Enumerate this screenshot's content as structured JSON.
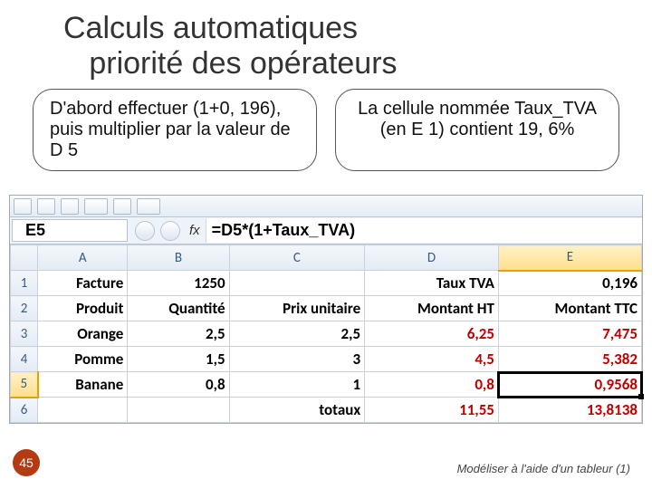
{
  "title_line1": "Calculs automatiques",
  "title_line2": "priorité des opérateurs",
  "callout_left": "D'abord effectuer (1+0, 196), puis multiplier par la valeur de D 5",
  "callout_right": "La cellule nommée Taux_TVA (en E 1) contient 19, 6%",
  "namebox": "E5",
  "fx_label": "fx",
  "formula": "=D5*(1+Taux_TVA)",
  "columns": [
    "A",
    "B",
    "C",
    "D",
    "E"
  ],
  "rows": [
    {
      "n": "1",
      "cells": [
        {
          "v": "Facture",
          "cls": "yel"
        },
        {
          "v": "1250",
          "cls": "bold"
        },
        {
          "v": "",
          "cls": ""
        },
        {
          "v": "Taux TVA",
          "cls": "yel"
        },
        {
          "v": "0,196",
          "cls": "bold"
        }
      ]
    },
    {
      "n": "2",
      "cells": [
        {
          "v": "Produit",
          "cls": "yel"
        },
        {
          "v": "Quantité",
          "cls": "yel"
        },
        {
          "v": "Prix unitaire",
          "cls": "yelr"
        },
        {
          "v": "Montant HT",
          "cls": "yelr"
        },
        {
          "v": "Montant TTC",
          "cls": "yelr"
        }
      ]
    },
    {
      "n": "3",
      "cells": [
        {
          "v": "Orange",
          "cls": "l bold"
        },
        {
          "v": "2,5",
          "cls": "bold"
        },
        {
          "v": "2,5",
          "cls": "bold"
        },
        {
          "v": "6,25",
          "cls": "red"
        },
        {
          "v": "7,475",
          "cls": "red"
        }
      ]
    },
    {
      "n": "4",
      "cells": [
        {
          "v": "Pomme",
          "cls": "l bold"
        },
        {
          "v": "1,5",
          "cls": "bold"
        },
        {
          "v": "3",
          "cls": "bold"
        },
        {
          "v": "4,5",
          "cls": "red"
        },
        {
          "v": "5,382",
          "cls": "red"
        }
      ]
    },
    {
      "n": "5",
      "cells": [
        {
          "v": "Banane",
          "cls": "l bold"
        },
        {
          "v": "0,8",
          "cls": "bold"
        },
        {
          "v": "1",
          "cls": "bold"
        },
        {
          "v": "0,8",
          "cls": "red"
        },
        {
          "v": "0,9568",
          "cls": "red active"
        }
      ],
      "sel": true
    },
    {
      "n": "6",
      "cells": [
        {
          "v": "",
          "cls": ""
        },
        {
          "v": "",
          "cls": ""
        },
        {
          "v": "totaux",
          "cls": "yelr"
        },
        {
          "v": "11,55",
          "cls": "red"
        },
        {
          "v": "13,8138",
          "cls": "red"
        }
      ]
    }
  ],
  "footer": "Modéliser à l'aide d'un tableur (1)",
  "slide_number": "45",
  "chart_data": {
    "type": "table",
    "title": "Calcul TTC avec Taux_TVA = 0,196",
    "columns": [
      "Produit",
      "Quantité",
      "Prix unitaire",
      "Montant HT",
      "Montant TTC"
    ],
    "rows": [
      [
        "Orange",
        2.5,
        2.5,
        6.25,
        7.475
      ],
      [
        "Pomme",
        1.5,
        3,
        4.5,
        5.382
      ],
      [
        "Banane",
        0.8,
        1,
        0.8,
        0.9568
      ]
    ],
    "totals": {
      "Montant HT": 11.55,
      "Montant TTC": 13.8138
    },
    "taux_tva": 0.196,
    "facture": 1250,
    "formula_E5": "=D5*(1+Taux_TVA)"
  }
}
